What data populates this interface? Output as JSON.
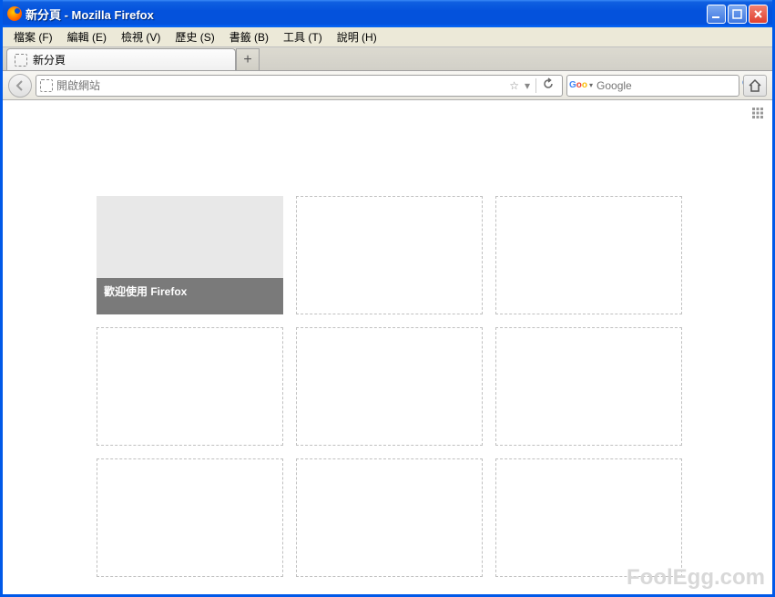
{
  "title": "新分頁 - Mozilla Firefox",
  "menubar": [
    "檔案 (F)",
    "編輯 (E)",
    "檢視 (V)",
    "歷史 (S)",
    "書籤 (B)",
    "工具 (T)",
    "說明 (H)"
  ],
  "tab": {
    "label": "新分頁"
  },
  "url": {
    "placeholder": "開啟網站"
  },
  "search": {
    "placeholder": "Google"
  },
  "tiles": [
    {
      "filled": true,
      "label": "歡迎使用 Firefox"
    },
    {
      "filled": false
    },
    {
      "filled": false
    },
    {
      "filled": false
    },
    {
      "filled": false
    },
    {
      "filled": false
    },
    {
      "filled": false
    },
    {
      "filled": false
    },
    {
      "filled": false
    }
  ],
  "watermark": "FoolEgg.com"
}
